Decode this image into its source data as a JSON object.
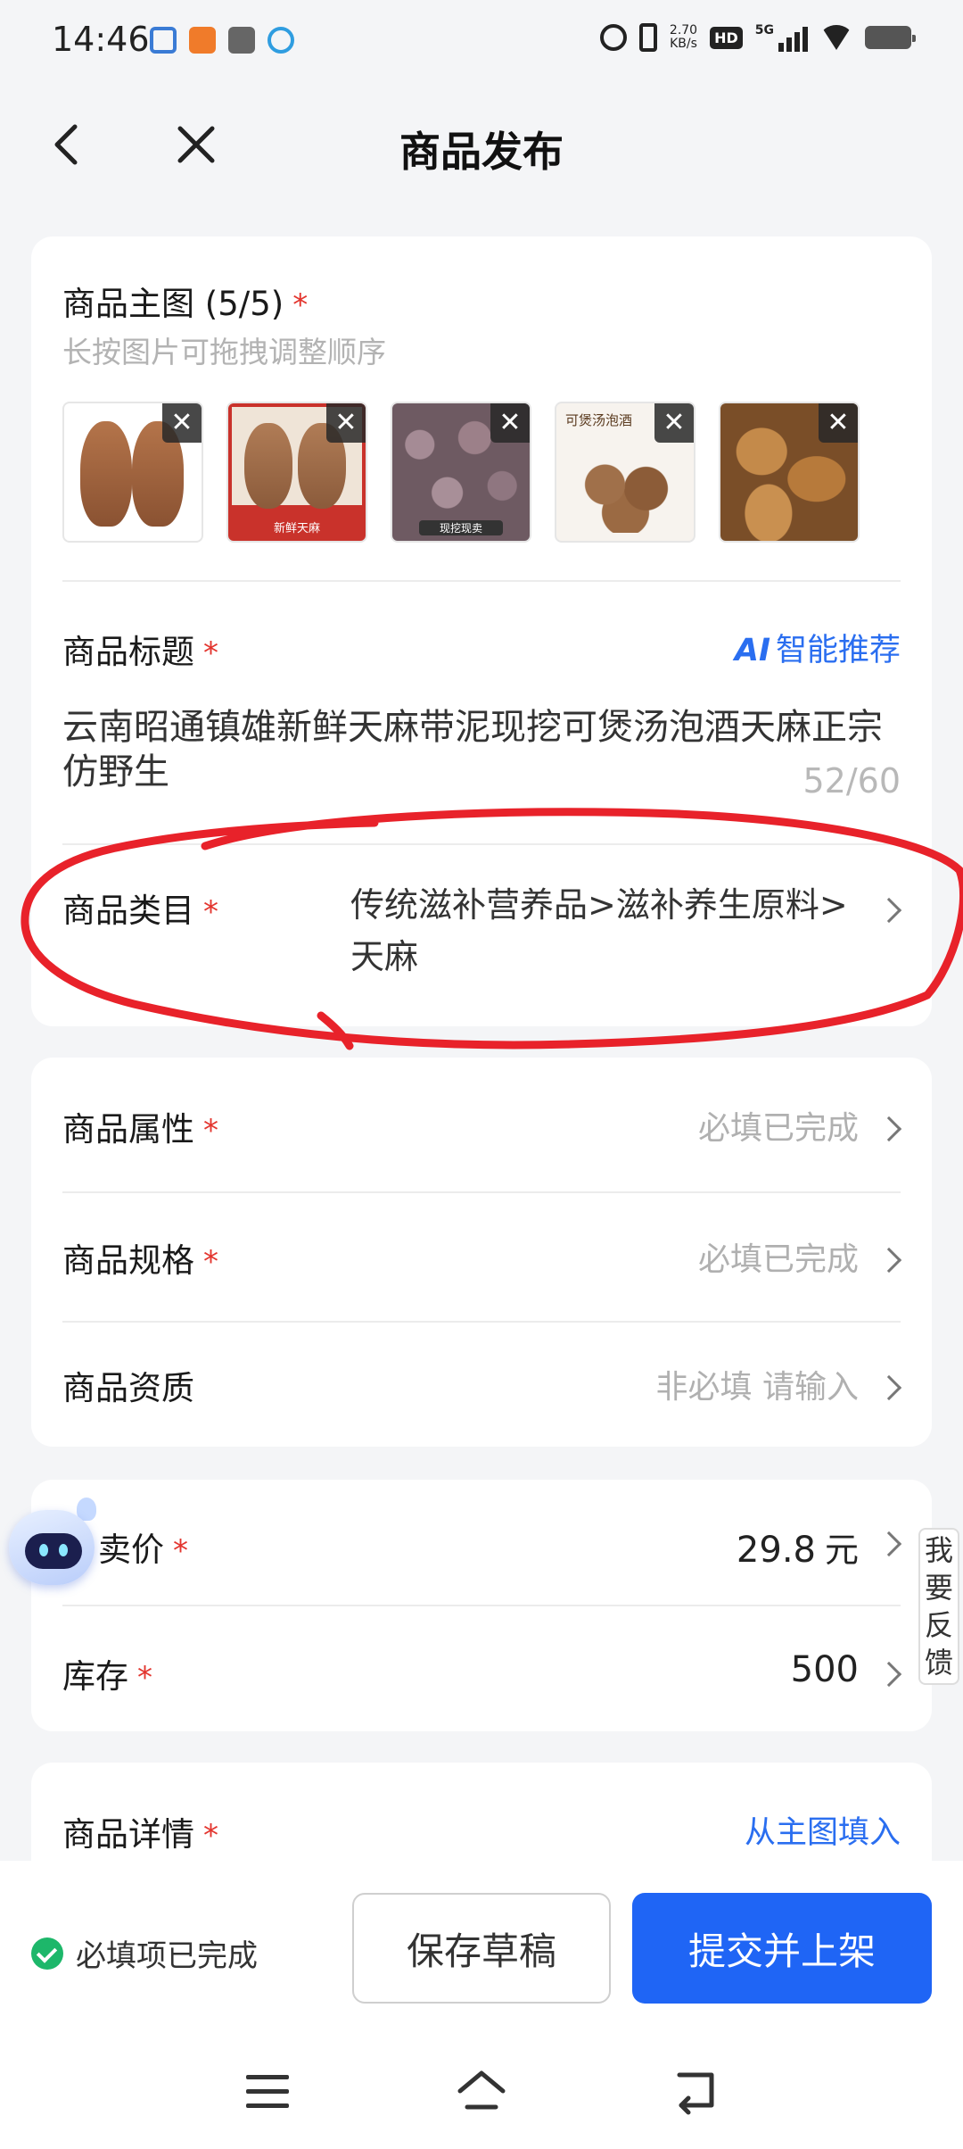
{
  "status_bar": {
    "time": "14:46",
    "net_speed_value": "2.70",
    "net_speed_unit": "KB/s",
    "hd_label": "HD",
    "network_label": "5G"
  },
  "nav": {
    "title": "商品发布"
  },
  "main_images": {
    "title": "商品主图 (5/5)",
    "hint": "长按图片可拖拽调整顺序",
    "thumbnails": [
      {
        "icon": "yam-photo-1"
      },
      {
        "icon": "yam-photo-2",
        "caption": "新鲜天麻"
      },
      {
        "icon": "yam-photo-3",
        "caption": "现挖现卖"
      },
      {
        "icon": "yam-photo-4",
        "caption": "可煲汤泡酒"
      },
      {
        "icon": "yam-photo-5"
      }
    ]
  },
  "product_title": {
    "label": "商品标题",
    "ai_recommend": "智能推荐",
    "ai_badge": "AI",
    "value": "云南昭通镇雄新鲜天麻带泥现挖可煲汤泡酒天麻正宗仿野生",
    "count": "52/60"
  },
  "category": {
    "label": "商品类目",
    "value": "传统滋补营养品>滋补养生原料>天麻"
  },
  "attributes": {
    "label": "商品属性",
    "value": "必填已完成"
  },
  "spec": {
    "label": "商品规格",
    "value": "必填已完成"
  },
  "qualification": {
    "label": "商品资质",
    "value": "非必填 请输入"
  },
  "price": {
    "label": "卖价",
    "value": "29.8",
    "unit": "元"
  },
  "stock": {
    "label": "库存",
    "value": "500"
  },
  "detail": {
    "label": "商品详情",
    "fill_link": "从主图填入"
  },
  "feedback": {
    "chars": [
      "我",
      "要",
      "反",
      "馈"
    ]
  },
  "bottom": {
    "status": "必填项已完成",
    "draft_button": "保存草稿",
    "submit_button": "提交并上架"
  },
  "required_mark": "*",
  "colors": {
    "accent": "#1f65f5",
    "required": "#e3352e",
    "success": "#1db76a",
    "annotation": "#e8222a"
  }
}
